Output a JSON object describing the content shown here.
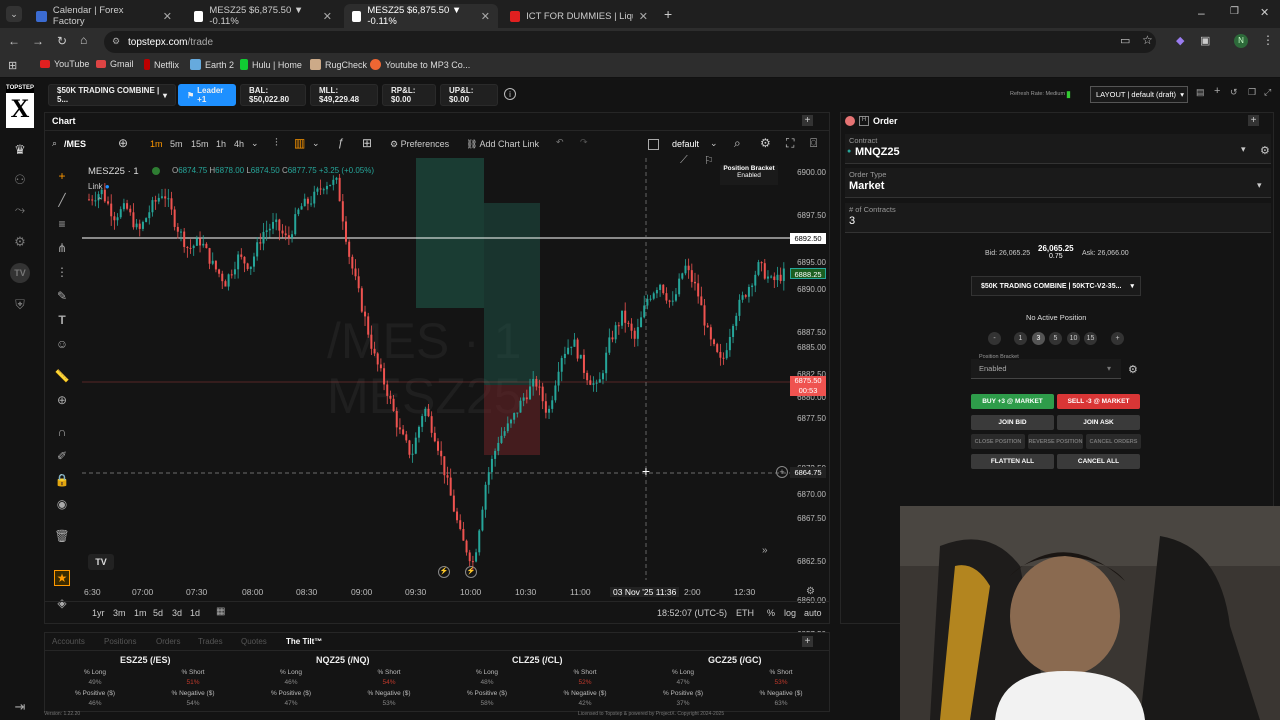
{
  "browser": {
    "tabs": [
      {
        "title": "Calendar | Forex Factory",
        "icon_color": "#3b6bd1"
      },
      {
        "title": "MESZ25 $6,875.50 ▼ -0.11%",
        "icon_color": "#ffffff"
      },
      {
        "title": "MESZ25 $6,875.50 ▼ -0.11%",
        "icon_color": "#ffffff",
        "active": true
      },
      {
        "title": "ICT FOR DUMMIES | Liquidity P...",
        "icon_color": "#e02020"
      }
    ],
    "url_domain": "topstepx.com",
    "url_path": "/trade",
    "bookmarks": [
      "YouTube",
      "Gmail",
      "Netflix",
      "Earth 2",
      "Hulu | Home",
      "RugCheck",
      "Youtube to MP3 Co..."
    ]
  },
  "app": {
    "logo_top": "TOPSTEP",
    "logo_letter": "X",
    "account_select": "$50K TRADING COMBINE | 5...",
    "leader_button": "Leader +1",
    "balance": "BAL: $50,022.80",
    "mll": "MLL: $49,229.48",
    "rpl": "RP&L: $0.00",
    "upl": "UP&L: $0.00",
    "refresh_rate": "Refresh Rate: Medium",
    "layout_select": "LAYOUT | default (draft)"
  },
  "chart": {
    "panel_title": "Chart",
    "symbol_search": "/MES",
    "timeframes": [
      "1m",
      "5m",
      "15m",
      "1h",
      "4h"
    ],
    "preferences": "Preferences",
    "add_chart_link": "Add Chart Link",
    "template": "default",
    "instrument_label": "MESZ25 · 1",
    "ohlc": {
      "o": "6874.75",
      "h": "6878.00",
      "l": "6874.50",
      "c": "6877.75",
      "chg": "+3.25 (+0.05%)"
    },
    "link_label": "Link",
    "tooltip_title": "Position Bracket",
    "tooltip_sub": "Enabled",
    "watermark_line1": "/MES · 1",
    "watermark_line2": "MESZ25",
    "price_ticks": [
      "6900.00",
      "6897.50",
      "6895.00",
      "6890.00",
      "6887.50",
      "6885.00",
      "6882.50",
      "6880.00",
      "6877.50",
      "6872.50",
      "6870.00",
      "6867.50",
      "6862.50",
      "6860.00",
      "6857.50",
      "6855.00",
      "6852.50"
    ],
    "price_flag_white": "6892.50",
    "price_flag_green": "6888.25",
    "price_flag_red": "6875.50",
    "price_flag_red_sub": "00:53",
    "crosshair_price": "6864.75",
    "time_ticks": [
      "6:30",
      "07:00",
      "07:30",
      "08:00",
      "08:30",
      "09:00",
      "09:30",
      "10:00",
      "10:30",
      "11:00",
      "2:00",
      "12:30"
    ],
    "crosshair_time": "03 Nov '25  11:36",
    "ranges": [
      "1yr",
      "3m",
      "1m",
      "5d",
      "3d",
      "1d"
    ],
    "clock": "18:52:07 (UTC-5)",
    "session": "ETH",
    "pct": "%",
    "log": "log",
    "auto": "auto"
  },
  "chart_data": {
    "type": "candlestick",
    "x_range": [
      "06:30",
      "12:45"
    ],
    "ylim": [
      6851,
      6902
    ],
    "close_path": [
      6897,
      6898,
      6895,
      6896,
      6893,
      6896,
      6898,
      6894,
      6891,
      6892,
      6889,
      6887,
      6890,
      6889,
      6893,
      6894,
      6892,
      6896,
      6897,
      6899,
      6899,
      6890,
      6884,
      6878,
      6874,
      6869,
      6866,
      6872,
      6868,
      6862,
      6856,
      6853,
      6863,
      6868,
      6870,
      6873,
      6875,
      6871,
      6878,
      6880,
      6876,
      6874,
      6880,
      6883,
      6880,
      6885,
      6887,
      6884,
      6889,
      6886,
      6880,
      6877,
      6883,
      6886,
      6889,
      6887,
      6888
    ]
  },
  "order": {
    "panel_title": "Order",
    "contract_label": "Contract",
    "contract": "MNQZ25",
    "order_type_label": "Order Type",
    "order_type": "Market",
    "contracts_label": "# of Contracts",
    "contracts": "3",
    "bid": "Bid: 26,065.25",
    "last": "26,065.25",
    "change": "0.75",
    "ask": "Ask: 26,066.00",
    "account": "$50K TRADING COMBINE | 50KTC-V2-35...",
    "position": "No Active Position",
    "qty_buttons": [
      "-",
      "1",
      "3",
      "5",
      "10",
      "15",
      "+"
    ],
    "bracket_label": "Position Bracket",
    "bracket_value": "Enabled",
    "buy": "BUY +3 @ MARKET",
    "sell": "SELL -3 @ MARKET",
    "join_bid": "JOIN BID",
    "join_ask": "JOIN ASK",
    "close_position": "CLOSE POSITION",
    "reverse_position": "REVERSE POSITION",
    "cancel_orders": "CANCEL ORDERS",
    "flatten_all": "FLATTEN ALL",
    "cancel_all": "CANCEL ALL"
  },
  "bottom": {
    "tabs": [
      "Accounts",
      "Positions",
      "Orders",
      "Trades",
      "Quotes",
      "The Tilt™"
    ],
    "tickers": [
      {
        "name": "ESZ25 (/ES)",
        "long": "49%",
        "short": "51%",
        "pos": "46%",
        "neg": "54%"
      },
      {
        "name": "NQZ25 (/NQ)",
        "long": "46%",
        "short": "54%",
        "pos": "47%",
        "neg": "53%"
      },
      {
        "name": "CLZ25 (/CL)",
        "long": "48%",
        "short": "52%",
        "pos": "58%",
        "neg": "42%"
      },
      {
        "name": "GCZ25 (/GC)",
        "long": "47%",
        "short": "53%",
        "pos": "37%",
        "neg": "63%"
      }
    ],
    "labels": {
      "long": "% Long",
      "short": "% Short",
      "pos": "% Positive ($)",
      "neg": "% Negative ($)"
    },
    "version": "Version: 1.22.20",
    "license": "Licensed to Topstep & powered by ProjectX. Copyright 2024-2025"
  },
  "colors": {
    "green": "#26a69a",
    "red": "#ef5350",
    "buy": "#2e9c4a",
    "sell": "#d93636",
    "accent": "#1e90ff"
  }
}
